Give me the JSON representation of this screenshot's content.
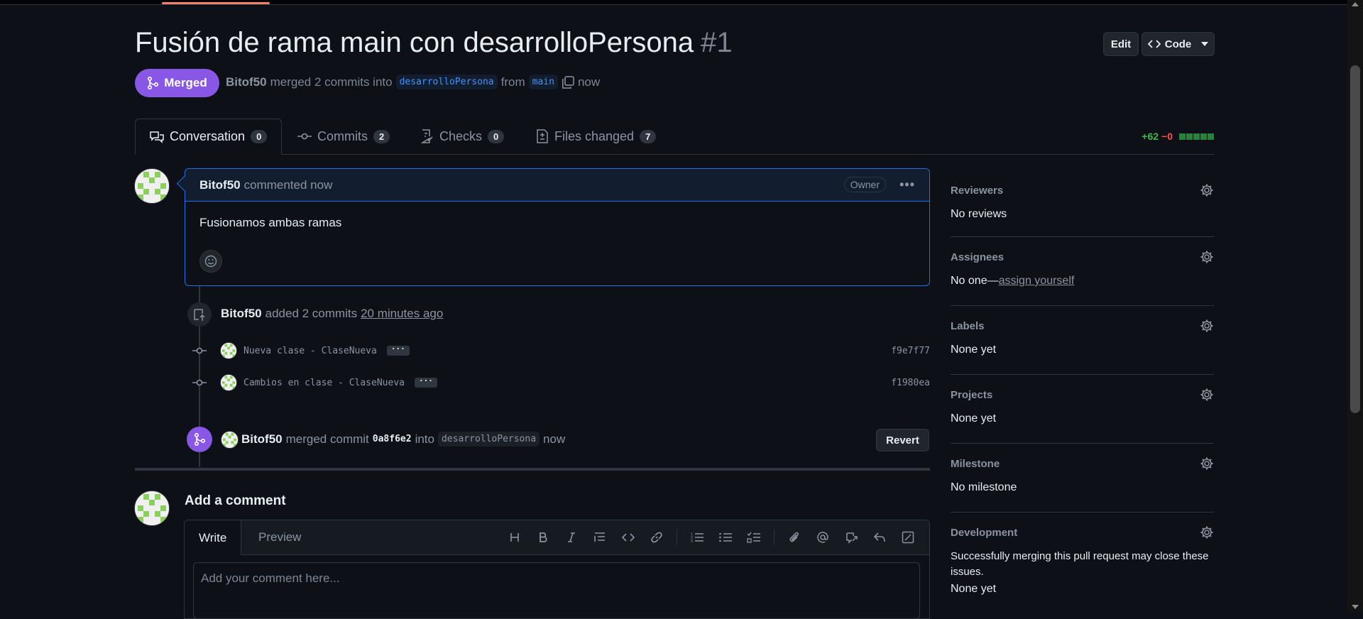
{
  "pr": {
    "title": "Fusión de rama main con desarrolloPersona",
    "number": "#1",
    "state": "Merged",
    "author": "Bitof50",
    "merged_text": "merged 2 commits into",
    "base_branch": "desarrolloPersona",
    "from_text": "from",
    "head_branch": "main",
    "time": "now"
  },
  "header_buttons": {
    "edit": "Edit",
    "code": "Code"
  },
  "tabs": [
    {
      "label": "Conversation",
      "count": "0"
    },
    {
      "label": "Commits",
      "count": "2"
    },
    {
      "label": "Checks",
      "count": "0"
    },
    {
      "label": "Files changed",
      "count": "7"
    }
  ],
  "diffstat": {
    "additions": "+62",
    "deletions": "−0",
    "blocks": 5
  },
  "comment": {
    "author": "Bitof50",
    "action": "commented now",
    "badge": "Owner",
    "body": "Fusionamos ambas ramas"
  },
  "commits_event": {
    "author": "Bitof50",
    "action": "added 2 commits",
    "time": "20 minutes ago",
    "commits": [
      {
        "message": "Nueva clase - ClaseNueva",
        "sha": "f9e7f77"
      },
      {
        "message": "Cambios en clase - ClaseNueva",
        "sha": "f1980ea"
      }
    ]
  },
  "merge_event": {
    "author": "Bitof50",
    "action": "merged commit",
    "sha": "0a8f6e2",
    "into_text": "into",
    "branch": "desarrolloPersona",
    "time": "now",
    "revert_label": "Revert"
  },
  "add_comment": {
    "title": "Add a comment",
    "write_tab": "Write",
    "preview_tab": "Preview",
    "placeholder": "Add your comment here..."
  },
  "sidebar": {
    "reviewers": {
      "heading": "Reviewers",
      "value": "No reviews"
    },
    "assignees": {
      "heading": "Assignees",
      "value": "No one—",
      "link": "assign yourself"
    },
    "labels": {
      "heading": "Labels",
      "value": "None yet"
    },
    "projects": {
      "heading": "Projects",
      "value": "None yet"
    },
    "milestone": {
      "heading": "Milestone",
      "value": "No milestone"
    },
    "development": {
      "heading": "Development",
      "description": "Successfully merging this pull request may close these issues.",
      "value": "None yet"
    }
  },
  "colors": {
    "background": "#0d1117",
    "merged_purple": "#8957e5",
    "accent_blue": "#1f6feb",
    "addition_green": "#3fb950",
    "deletion_red": "#f85149",
    "tab_underline": "#f78166"
  }
}
